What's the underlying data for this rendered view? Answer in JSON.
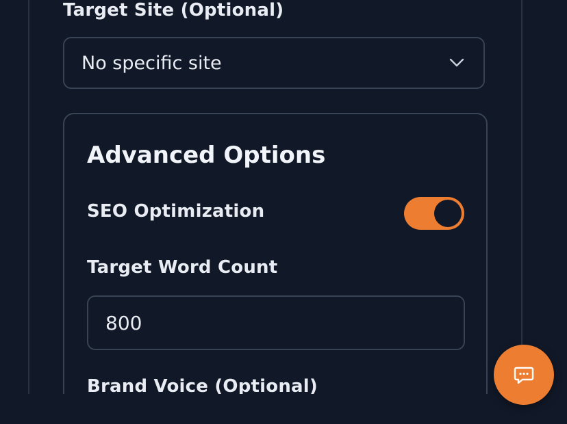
{
  "form": {
    "target_site_label": "Target Site (Optional)",
    "target_site_value": "No specific site",
    "advanced": {
      "title": "Advanced Options",
      "seo_label": "SEO Optimization",
      "seo_enabled": true,
      "word_count_label": "Target Word Count",
      "word_count_value": "800",
      "brand_voice_label": "Brand Voice (Optional)"
    }
  },
  "icons": {
    "select_chevron": "chevron-down-icon",
    "chat_button": "chat-message-icon"
  },
  "colors": {
    "background": "#111827",
    "accent": "#ed7d31",
    "border": "#384455",
    "text": "#e9edf3"
  }
}
